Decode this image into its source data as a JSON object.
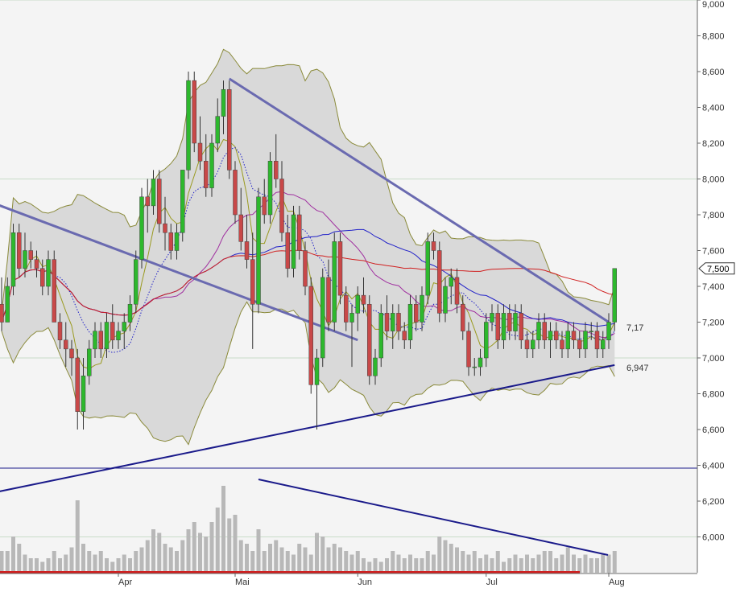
{
  "chart_data": {
    "type": "candlestick",
    "colors": {
      "up": "#2db82d",
      "down": "#c84848",
      "bollinger_fill": "#d9d9d9",
      "bollinger_line": "#8a8a3a",
      "ma_short": "#2020c8",
      "ma_medium": "#a030a0",
      "ma_long": "#d02020",
      "ma_ultrashort": "#9a9a20",
      "trendline": "#1a1a8a",
      "trendline_light": "#6a6ab0",
      "volume": "#b8b8b8",
      "plot_bg": "#f4f4f4",
      "grid": "#c8dcc8"
    },
    "y_axis": {
      "min": 5.8,
      "max": 9.0,
      "ticks": [
        "6,000",
        "6,200",
        "6,400",
        "6,600",
        "6,800",
        "7,000",
        "7,200",
        "7,400",
        "7,600",
        "7,800",
        "8,000",
        "8,200",
        "8,400",
        "8,600",
        "8,800",
        "9,000"
      ],
      "tick_values": [
        6.0,
        6.2,
        6.4,
        6.6,
        6.8,
        7.0,
        7.2,
        7.4,
        7.6,
        7.8,
        8.0,
        8.2,
        8.4,
        8.6,
        8.8,
        9.0
      ],
      "gridlines": [
        6.0,
        7.0,
        8.0,
        9.0
      ]
    },
    "x_axis": {
      "labels": [
        "Apr",
        "Mai",
        "Jun",
        "Jul",
        "Aug"
      ],
      "label_bar_index": [
        20,
        40,
        61,
        83,
        104
      ],
      "total_bars": 106
    },
    "last_price_label": "7,500",
    "last_price_value": 7.5,
    "annotations": [
      {
        "text": "7,17",
        "value": 7.17
      },
      {
        "text": "6,947",
        "value": 6.947
      }
    ],
    "candles_ohlc": [
      [
        7.3,
        7.45,
        7.15,
        7.2
      ],
      [
        7.2,
        7.45,
        7.2,
        7.4
      ],
      [
        7.4,
        7.75,
        7.35,
        7.7
      ],
      [
        7.7,
        7.75,
        7.45,
        7.5
      ],
      [
        7.5,
        7.7,
        7.45,
        7.6
      ],
      [
        7.6,
        7.65,
        7.5,
        7.55
      ],
      [
        7.55,
        7.6,
        7.45,
        7.5
      ],
      [
        7.5,
        7.55,
        7.35,
        7.4
      ],
      [
        7.4,
        7.6,
        7.35,
        7.55
      ],
      [
        7.55,
        7.6,
        7.2,
        7.2
      ],
      [
        7.2,
        7.25,
        7.05,
        7.1
      ],
      [
        7.1,
        7.2,
        6.95,
        7.05
      ],
      [
        7.05,
        7.1,
        6.9,
        7.0
      ],
      [
        7.0,
        7.05,
        6.6,
        6.7
      ],
      [
        6.7,
        7.0,
        6.6,
        6.9
      ],
      [
        6.9,
        7.1,
        6.85,
        7.05
      ],
      [
        7.05,
        7.2,
        7.0,
        7.15
      ],
      [
        7.15,
        7.2,
        7.0,
        7.05
      ],
      [
        7.05,
        7.25,
        7.0,
        7.2
      ],
      [
        7.2,
        7.3,
        7.05,
        7.1
      ],
      [
        7.1,
        7.2,
        7.05,
        7.15
      ],
      [
        7.15,
        7.25,
        7.05,
        7.2
      ],
      [
        7.2,
        7.35,
        7.15,
        7.3
      ],
      [
        7.3,
        7.6,
        7.25,
        7.55
      ],
      [
        7.55,
        7.95,
        7.5,
        7.9
      ],
      [
        7.9,
        8.0,
        7.7,
        7.85
      ],
      [
        7.85,
        8.05,
        7.8,
        8.0
      ],
      [
        8.0,
        8.05,
        7.7,
        7.75
      ],
      [
        7.75,
        7.9,
        7.6,
        7.7
      ],
      [
        7.7,
        7.75,
        7.55,
        7.6
      ],
      [
        7.6,
        7.75,
        7.55,
        7.7
      ],
      [
        7.7,
        8.05,
        7.65,
        8.05
      ],
      [
        8.05,
        8.6,
        8.0,
        8.55
      ],
      [
        8.55,
        8.6,
        8.15,
        8.2
      ],
      [
        8.2,
        8.35,
        8.05,
        8.1
      ],
      [
        8.1,
        8.25,
        7.9,
        7.95
      ],
      [
        7.95,
        8.25,
        7.9,
        8.2
      ],
      [
        8.2,
        8.45,
        8.15,
        8.35
      ],
      [
        8.35,
        8.55,
        8.25,
        8.5
      ],
      [
        8.5,
        8.55,
        8.0,
        8.05
      ],
      [
        8.05,
        8.1,
        7.75,
        7.8
      ],
      [
        7.8,
        7.95,
        7.6,
        7.65
      ],
      [
        7.65,
        7.8,
        7.5,
        7.55
      ],
      [
        7.55,
        7.7,
        7.05,
        7.3
      ],
      [
        7.3,
        7.95,
        7.25,
        7.9
      ],
      [
        7.9,
        8.0,
        7.75,
        7.8
      ],
      [
        7.8,
        8.15,
        7.75,
        8.1
      ],
      [
        8.1,
        8.25,
        7.95,
        8.0
      ],
      [
        8.0,
        8.1,
        7.65,
        7.7
      ],
      [
        7.7,
        7.8,
        7.45,
        7.5
      ],
      [
        7.5,
        7.85,
        7.45,
        7.8
      ],
      [
        7.8,
        7.85,
        7.55,
        7.6
      ],
      [
        7.6,
        7.65,
        7.35,
        7.4
      ],
      [
        7.4,
        7.45,
        6.8,
        6.85
      ],
      [
        6.85,
        7.05,
        6.6,
        7.0
      ],
      [
        7.0,
        7.5,
        6.95,
        7.45
      ],
      [
        7.45,
        7.55,
        7.15,
        7.2
      ],
      [
        7.2,
        7.7,
        7.15,
        7.65
      ],
      [
        7.65,
        7.7,
        7.3,
        7.35
      ],
      [
        7.35,
        7.4,
        7.15,
        7.2
      ],
      [
        7.2,
        7.3,
        6.95,
        7.25
      ],
      [
        7.25,
        7.4,
        7.15,
        7.35
      ],
      [
        7.35,
        7.45,
        7.25,
        7.3
      ],
      [
        7.3,
        7.35,
        6.85,
        6.9
      ],
      [
        6.9,
        7.05,
        6.85,
        7.0
      ],
      [
        7.0,
        7.3,
        6.95,
        7.25
      ],
      [
        7.25,
        7.35,
        7.1,
        7.15
      ],
      [
        7.15,
        7.3,
        7.05,
        7.25
      ],
      [
        7.25,
        7.3,
        7.1,
        7.15
      ],
      [
        7.15,
        7.2,
        7.05,
        7.1
      ],
      [
        7.1,
        7.35,
        7.05,
        7.3
      ],
      [
        7.3,
        7.35,
        7.15,
        7.2
      ],
      [
        7.2,
        7.4,
        7.15,
        7.35
      ],
      [
        7.35,
        7.7,
        7.3,
        7.65
      ],
      [
        7.65,
        7.7,
        7.55,
        7.6
      ],
      [
        7.6,
        7.65,
        7.2,
        7.25
      ],
      [
        7.25,
        7.45,
        7.2,
        7.4
      ],
      [
        7.4,
        7.5,
        7.3,
        7.45
      ],
      [
        7.45,
        7.5,
        7.25,
        7.3
      ],
      [
        7.3,
        7.35,
        7.1,
        7.15
      ],
      [
        7.15,
        7.2,
        6.9,
        6.95
      ],
      [
        6.95,
        7.0,
        6.9,
        6.95
      ],
      [
        6.95,
        7.05,
        6.9,
        7.0
      ],
      [
        7.0,
        7.25,
        6.95,
        7.2
      ],
      [
        7.2,
        7.3,
        7.15,
        7.25
      ],
      [
        7.25,
        7.3,
        7.05,
        7.1
      ],
      [
        7.1,
        7.3,
        7.05,
        7.25
      ],
      [
        7.25,
        7.3,
        7.1,
        7.15
      ],
      [
        7.15,
        7.3,
        7.1,
        7.25
      ],
      [
        7.25,
        7.3,
        7.05,
        7.1
      ],
      [
        7.1,
        7.15,
        7.0,
        7.05
      ],
      [
        7.05,
        7.15,
        7.0,
        7.1
      ],
      [
        7.1,
        7.25,
        7.05,
        7.2
      ],
      [
        7.2,
        7.25,
        7.05,
        7.1
      ],
      [
        7.1,
        7.2,
        7.0,
        7.15
      ],
      [
        7.15,
        7.2,
        7.05,
        7.1
      ],
      [
        7.1,
        7.15,
        7.0,
        7.05
      ],
      [
        7.05,
        7.2,
        7.0,
        7.15
      ],
      [
        7.15,
        7.2,
        7.05,
        7.1
      ],
      [
        7.1,
        7.15,
        7.0,
        7.05
      ],
      [
        7.05,
        7.2,
        7.0,
        7.15
      ],
      [
        7.15,
        7.2,
        7.1,
        7.15
      ],
      [
        7.15,
        7.2,
        7.0,
        7.05
      ],
      [
        7.05,
        7.15,
        7.0,
        7.1
      ],
      [
        7.1,
        7.25,
        7.05,
        7.2
      ],
      [
        7.2,
        7.5,
        7.15,
        7.5
      ]
    ],
    "volume_norm": [
      0.3,
      0.3,
      0.5,
      0.4,
      0.25,
      0.2,
      0.2,
      0.15,
      0.2,
      0.3,
      0.2,
      0.25,
      0.35,
      1.0,
      0.4,
      0.3,
      0.25,
      0.3,
      0.2,
      0.15,
      0.2,
      0.25,
      0.2,
      0.3,
      0.35,
      0.45,
      0.6,
      0.55,
      0.4,
      0.35,
      0.3,
      0.45,
      0.6,
      0.7,
      0.55,
      0.5,
      0.7,
      0.9,
      1.2,
      0.75,
      0.8,
      0.45,
      0.4,
      0.3,
      0.6,
      0.3,
      0.4,
      0.45,
      0.35,
      0.3,
      0.25,
      0.4,
      0.35,
      0.25,
      0.55,
      0.5,
      0.35,
      0.4,
      0.35,
      0.3,
      0.25,
      0.3,
      0.2,
      0.15,
      0.2,
      0.15,
      0.2,
      0.3,
      0.25,
      0.2,
      0.25,
      0.2,
      0.2,
      0.3,
      0.25,
      0.5,
      0.45,
      0.4,
      0.35,
      0.3,
      0.25,
      0.3,
      0.2,
      0.25,
      0.2,
      0.3,
      0.15,
      0.2,
      0.25,
      0.2,
      0.25,
      0.2,
      0.25,
      0.3,
      0.3,
      0.2,
      0.25,
      0.35,
      0.25,
      0.2,
      0.25,
      0.2,
      0.2,
      0.25,
      0.25,
      0.3
    ]
  }
}
